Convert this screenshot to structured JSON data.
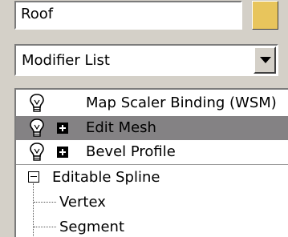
{
  "object_name": {
    "value": "Roof"
  },
  "object_color": "#e8c55c",
  "modifier_list": {
    "label": "Modifier List"
  },
  "stack": {
    "modifiers": [
      {
        "label": "Map Scaler Binding (WSM)",
        "icon": "lightbulb-icon",
        "expandable": false,
        "selected": false
      },
      {
        "label": "Edit Mesh",
        "icon": "lightbulb-icon",
        "expandable": true,
        "selected": true
      },
      {
        "label": "Bevel Profile",
        "icon": "lightbulb-icon",
        "expandable": true,
        "selected": false
      }
    ],
    "base_object": {
      "label": "Editable Spline",
      "sub_objects": [
        "Vertex",
        "Segment"
      ]
    }
  }
}
